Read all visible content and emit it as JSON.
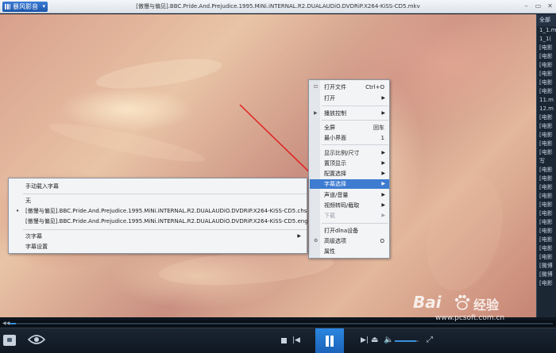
{
  "titlebar": {
    "app_name": "暴风影音",
    "window_title": "[傲慢与偏见].BBC.Pride.And.Prejudice.1995.MiNi.iNTERNAL.R2.DUALAUDiO.DVDRiP.X264-KiSS-CD5.mkv",
    "minimize": "–",
    "restore": "▭",
    "close": "✕"
  },
  "playlist": {
    "header": "全部",
    "items": [
      "1_1.m",
      "1_1(",
      "[电影",
      "[电影",
      "[电影",
      "[电影",
      "[电影",
      "[电影",
      "11.m",
      "12.m",
      "[电影",
      "[电影",
      "[电影",
      "[电影",
      "[电影"
    ],
    "group_header": "写",
    "items2": [
      "[电影",
      "[电影",
      "[电影",
      "[电影",
      "[电影",
      "[电影",
      "[电影",
      "[电影",
      "[电影",
      "[电影",
      "[电影",
      "[微博",
      "[微博",
      "[电影"
    ]
  },
  "progress": {
    "fraction": 0.012
  },
  "volume": {
    "fraction": 0.9
  },
  "context_menu": {
    "items": [
      {
        "label": "打开文件",
        "shortcut": "Ctrl+O",
        "lead": "⊡"
      },
      {
        "label": "打开",
        "submenu": true
      },
      {
        "label": "播放控制",
        "submenu": true,
        "lead": "▶"
      },
      {
        "label": "全屏",
        "shortcut": "回车"
      },
      {
        "label": "最小界面",
        "shortcut": "1"
      },
      {
        "label": "显示比例/尺寸",
        "submenu": true
      },
      {
        "label": "置顶显示",
        "submenu": true
      },
      {
        "label": "配置选择",
        "submenu": true
      },
      {
        "label": "字幕选择",
        "submenu": true,
        "highlighted": true
      },
      {
        "label": "声道/音量",
        "submenu": true
      },
      {
        "label": "视频转码/截取",
        "submenu": true
      },
      {
        "label": "下载",
        "submenu": true,
        "disabled": true
      },
      {
        "label": "打开dlna设备"
      },
      {
        "label": "高级选项",
        "shortcut": "O",
        "lead": "⚙"
      },
      {
        "label": "属性"
      }
    ]
  },
  "subtitle_menu": {
    "manual_load": "手动载入字幕",
    "none": "无",
    "file_chs": "[傲慢与偏见].BBC.Pride.And.Prejudice.1995.MiNi.iNTERNAL.R2.DUALAUDiO.DVDRiP.X264-KiSS-CD5.chs",
    "file_eng": "[傲慢与偏见].BBC.Pride.And.Prejudice.1995.MiNi.iNTERNAL.R2.DUALAUDiO.DVDRiP.X264-KiSS-CD5.eng",
    "secondary": "次字幕",
    "settings": "字幕设置",
    "selected_bullet": "•"
  },
  "controls": {
    "prev": "|◀",
    "next": "▶|",
    "eject": "⏏",
    "volume": "🔈",
    "fullscreen": "⤢",
    "progress_back": "◀◀"
  },
  "watermark": {
    "brand": "Bai",
    "brand_cn": "经验",
    "url": "www.pcsoft.com.cn"
  },
  "colors": {
    "accent": "#3d7cd1",
    "play_button": "#2b86e0",
    "annotation_arrow": "#e02020"
  }
}
